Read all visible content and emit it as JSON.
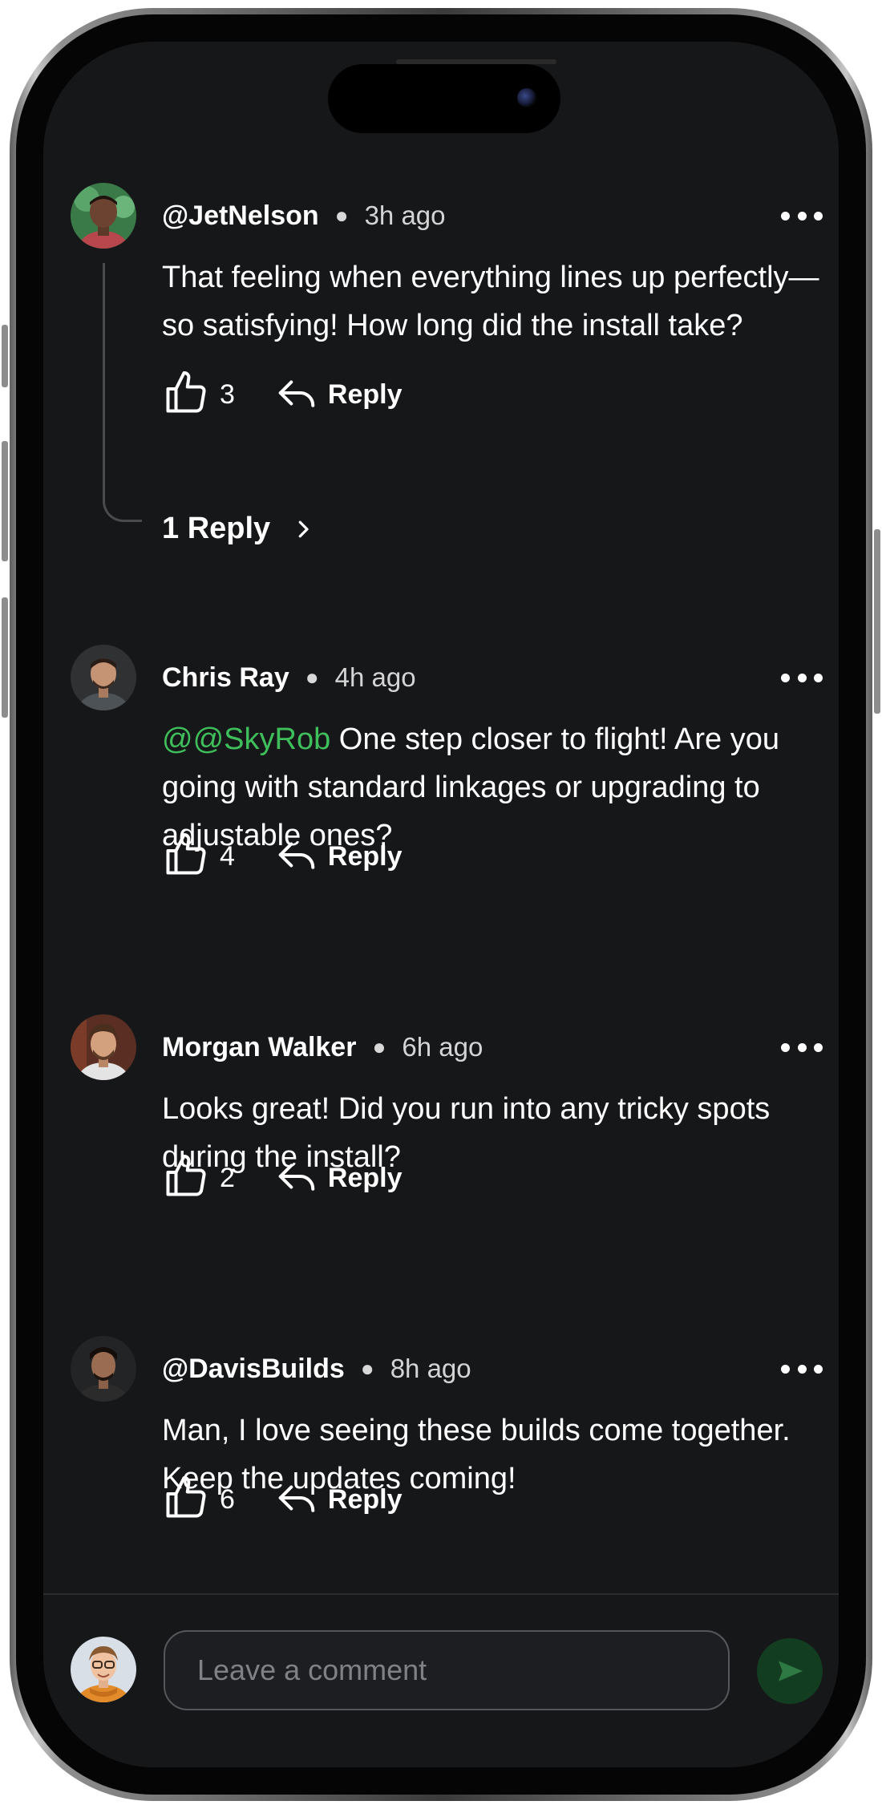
{
  "comments": [
    {
      "author": "@JetNelson",
      "time": "3h ago",
      "mention": "",
      "text": "That feeling when everything lines up perfectly—so satisfying! How long did the install take?",
      "likes": "3",
      "reply_label": "Reply",
      "replies_label": "1 Reply"
    },
    {
      "author": "Chris Ray",
      "time": "4h ago",
      "mention": "@@SkyRob",
      "text": " One step closer to flight! Are you going with standard linkages or upgrading to adjustable ones?",
      "likes": "4",
      "reply_label": "Reply"
    },
    {
      "author": "Morgan Walker",
      "time": "6h ago",
      "mention": "",
      "text": "Looks great! Did you run into any tricky spots during the install?",
      "likes": "2",
      "reply_label": "Reply"
    },
    {
      "author": "@DavisBuilds",
      "time": "8h ago",
      "mention": "",
      "text": "Man, I love seeing these builds come together. Keep the updates coming!",
      "likes": "6",
      "reply_label": "Reply"
    }
  ],
  "composer": {
    "placeholder": "Leave a comment",
    "value": ""
  },
  "colors": {
    "background": "#161719",
    "mention": "#3fbf5c",
    "send_button": "#133d20"
  },
  "icons": [
    "more-icon",
    "thumbs-up-icon",
    "reply-arrow-icon",
    "chevron-right-icon",
    "send-icon"
  ]
}
